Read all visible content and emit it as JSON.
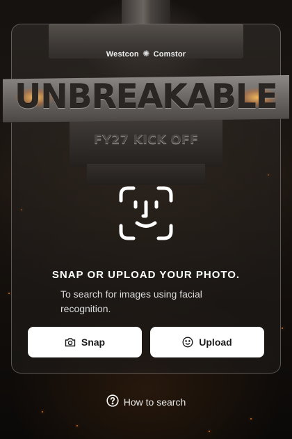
{
  "brand": {
    "left": "Westcon",
    "right": "Comstor"
  },
  "banner": {
    "title": "UNBREAKABLE",
    "subtitle": "FY27 KICK OFF"
  },
  "icons": {
    "face": "face-id-icon",
    "snap": "camera-icon",
    "upload": "smiley-icon",
    "help": "help-circle-icon"
  },
  "main": {
    "heading": "SNAP OR UPLOAD YOUR PHOTO.",
    "description": "To search for images using facial recognition."
  },
  "actions": {
    "snap_label": "Snap",
    "upload_label": "Upload"
  },
  "footer": {
    "help_label": "How to search"
  },
  "colors": {
    "button_bg": "#ffffff",
    "text": "#ffffff",
    "accent_spark": "#ff8a2a"
  }
}
